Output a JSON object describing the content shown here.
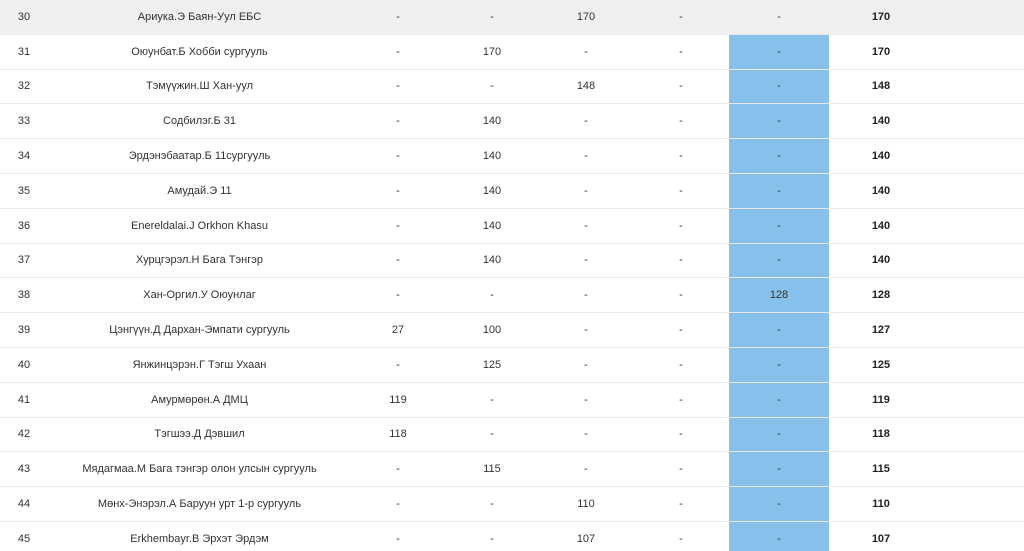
{
  "highlight_color": "#87c0ea",
  "rows": [
    {
      "rank": "30",
      "name": "Ариука.Э Баян-Уул ЕБС",
      "s1": "-",
      "s2": "-",
      "s3": "170",
      "s4": "-",
      "s5": "-",
      "total": "170"
    },
    {
      "rank": "31",
      "name": "Оюунбат.Б Хобби сургууль",
      "s1": "-",
      "s2": "170",
      "s3": "-",
      "s4": "-",
      "s5": "-",
      "total": "170"
    },
    {
      "rank": "32",
      "name": "Тэмүүжин.Ш Хан-уул",
      "s1": "-",
      "s2": "-",
      "s3": "148",
      "s4": "-",
      "s5": "-",
      "total": "148"
    },
    {
      "rank": "33",
      "name": "Содбилэг.Б 31",
      "s1": "-",
      "s2": "140",
      "s3": "-",
      "s4": "-",
      "s5": "-",
      "total": "140"
    },
    {
      "rank": "34",
      "name": "Эрдэнэбаатар.Б 11сургууль",
      "s1": "-",
      "s2": "140",
      "s3": "-",
      "s4": "-",
      "s5": "-",
      "total": "140"
    },
    {
      "rank": "35",
      "name": "Амудай.Э 11",
      "s1": "-",
      "s2": "140",
      "s3": "-",
      "s4": "-",
      "s5": "-",
      "total": "140"
    },
    {
      "rank": "36",
      "name": "Enereldalai.J Orkhon Khasu",
      "s1": "-",
      "s2": "140",
      "s3": "-",
      "s4": "-",
      "s5": "-",
      "total": "140"
    },
    {
      "rank": "37",
      "name": "Хурцгэрэл.Н Бага Тэнгэр",
      "s1": "-",
      "s2": "140",
      "s3": "-",
      "s4": "-",
      "s5": "-",
      "total": "140"
    },
    {
      "rank": "38",
      "name": "Хан-Оргил.У Оюунлаг",
      "s1": "-",
      "s2": "-",
      "s3": "-",
      "s4": "-",
      "s5": "128",
      "total": "128"
    },
    {
      "rank": "39",
      "name": "Цэнгүүн.Д Дархан-Эмпати сургууль",
      "s1": "27",
      "s2": "100",
      "s3": "-",
      "s4": "-",
      "s5": "-",
      "total": "127"
    },
    {
      "rank": "40",
      "name": "Янжинцэрэн.Г Тэгш Ухаан",
      "s1": "-",
      "s2": "125",
      "s3": "-",
      "s4": "-",
      "s5": "-",
      "total": "125"
    },
    {
      "rank": "41",
      "name": "Амурмөрөн.А ДМЦ",
      "s1": "119",
      "s2": "-",
      "s3": "-",
      "s4": "-",
      "s5": "-",
      "total": "119"
    },
    {
      "rank": "42",
      "name": "Тэгшээ.Д Дэвшил",
      "s1": "118",
      "s2": "-",
      "s3": "-",
      "s4": "-",
      "s5": "-",
      "total": "118"
    },
    {
      "rank": "43",
      "name": "Мядагмаа.М Бага тэнгэр олон улсын сургууль",
      "s1": "-",
      "s2": "115",
      "s3": "-",
      "s4": "-",
      "s5": "-",
      "total": "115"
    },
    {
      "rank": "44",
      "name": "Мөнх-Энэрэл.А Баруун урт 1-р сургууль",
      "s1": "-",
      "s2": "-",
      "s3": "110",
      "s4": "-",
      "s5": "-",
      "total": "110"
    },
    {
      "rank": "45",
      "name": "Erkhembayr.B Эрхэт Эрдэм",
      "s1": "-",
      "s2": "-",
      "s3": "107",
      "s4": "-",
      "s5": "-",
      "total": "107"
    }
  ]
}
